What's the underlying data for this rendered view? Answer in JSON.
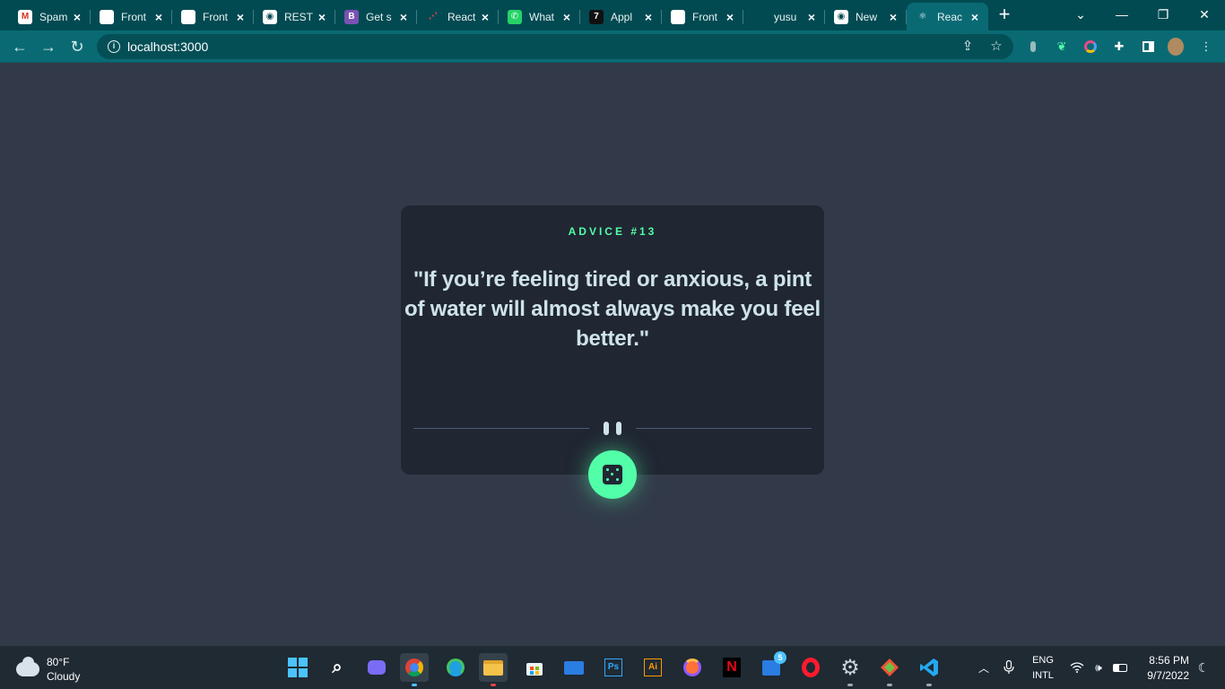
{
  "browser": {
    "tabs": [
      {
        "title": "Spam",
        "icon": "gmail-icon",
        "fav_text": "M",
        "fav_bg": "#ffffff",
        "fav_fg": "#d93025"
      },
      {
        "title": "Front",
        "icon": "frontend-mentor-icon",
        "fav_text": "",
        "fav_bg": "#ffffff",
        "fav_fg": "#3f54a3"
      },
      {
        "title": "Front",
        "icon": "frontend-mentor-icon",
        "fav_text": "",
        "fav_bg": "#ffffff",
        "fav_fg": "#3f54a3"
      },
      {
        "title": "REST",
        "icon": "globe-icon",
        "fav_text": "◉",
        "fav_bg": "#ffffff",
        "fav_fg": "#024a52"
      },
      {
        "title": "Get s",
        "icon": "bootstrap-icon",
        "fav_text": "B",
        "fav_bg": "#7952b3",
        "fav_fg": "#ffffff"
      },
      {
        "title": "React",
        "icon": "react-router-icon",
        "fav_text": "⋰",
        "fav_bg": "#024a52",
        "fav_fg": "#e8404b"
      },
      {
        "title": "What",
        "icon": "whatsapp-icon",
        "fav_text": "✆",
        "fav_bg": "#25d366",
        "fav_fg": "#ffffff"
      },
      {
        "title": "Appl",
        "icon": "seven-icon",
        "fav_text": "7",
        "fav_bg": "#111111",
        "fav_fg": "#ffffff"
      },
      {
        "title": "Front",
        "icon": "frontend-mentor-icon",
        "fav_text": "",
        "fav_bg": "#ffffff",
        "fav_fg": "#3f54a3"
      },
      {
        "title": "yusu",
        "icon": "github-icon",
        "fav_text": "",
        "fav_bg": "#024a52",
        "fav_fg": "#111111"
      },
      {
        "title": "New",
        "icon": "chrome-icon",
        "fav_text": "◉",
        "fav_bg": "#ffffff",
        "fav_fg": "#024a52"
      },
      {
        "title": "Reac",
        "icon": "react-icon",
        "fav_text": "⚛",
        "fav_bg": "#0a6a73",
        "fav_fg": "#dfefff",
        "active": true
      }
    ],
    "address": {
      "url": "localhost:3000"
    }
  },
  "card": {
    "advice_label": "ADVICE #13",
    "quote": "\"If you’re feeling tired or anxious, a pint of water will almost always make you feel better.\""
  },
  "taskbar": {
    "weather": {
      "temp": "80°F",
      "condition": "Cloudy"
    },
    "lang": {
      "line1": "ENG",
      "line2": "INTL"
    },
    "clock": {
      "time": "8:56 PM",
      "date": "9/7/2022"
    },
    "badge_count": "5"
  },
  "colors": {
    "accent": "#52ffa8",
    "card": "#202632",
    "page": "#323a49",
    "text": "#cee3e9",
    "browser_frame": "#024a52"
  }
}
